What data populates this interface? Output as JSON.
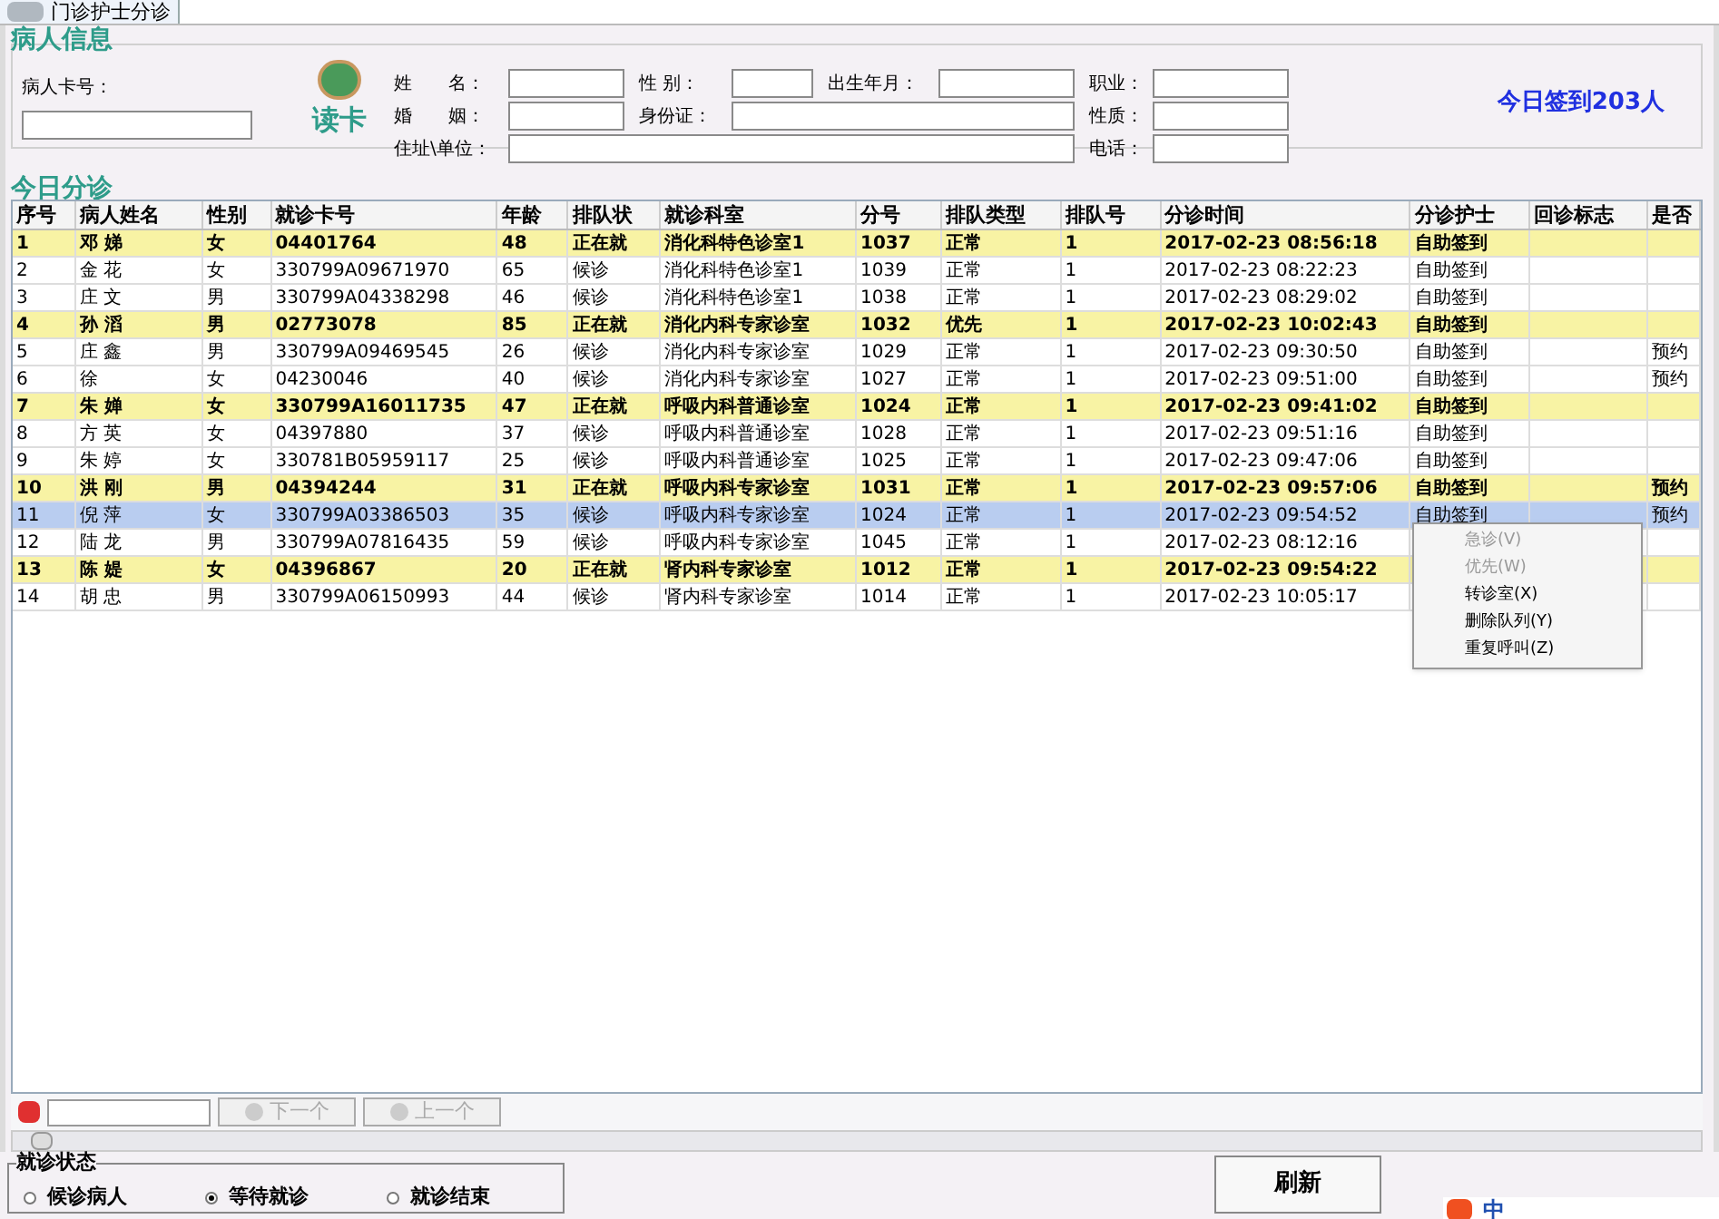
{
  "tab": {
    "label": "门诊护士分诊",
    "selected": true
  },
  "patient_info": {
    "title": "病人信息",
    "card_label": "病人卡号：",
    "read_card": "读卡",
    "signed_in": "今日签到203人",
    "field_rows": [
      [
        "姓　　名：",
        "性 别：",
        "出生年月：",
        "职业："
      ],
      [
        "婚　　姻：",
        "身份证：",
        "性质："
      ],
      [
        "住址\\单位：",
        "电话："
      ]
    ]
  },
  "triage": {
    "title": "今日分诊",
    "columns": [
      "序号",
      "病人姓名",
      "性别",
      "就诊卡号",
      "年龄",
      "排队状",
      "就诊科室",
      "分号",
      "排队类型",
      "排队号",
      "分诊时间",
      "分诊护士",
      "回诊标志",
      "是否"
    ],
    "rows": [
      {
        "cells": [
          "1",
          "邓 娣",
          "女",
          "04401764",
          "48",
          "正在就",
          "消化科特色诊室1",
          "1037",
          "正常",
          "1",
          "2017-02-23 08:56:18",
          "自助签到",
          "",
          ""
        ],
        "highlighted": true,
        "selected": false
      },
      {
        "cells": [
          "2",
          "金 花",
          "女",
          "330799A09671970",
          "65",
          "候诊",
          "消化科特色诊室1",
          "1039",
          "正常",
          "1",
          "2017-02-23 08:22:23",
          "自助签到",
          "",
          ""
        ],
        "highlighted": false,
        "selected": false
      },
      {
        "cells": [
          "3",
          "庄 文",
          "男",
          "330799A04338298",
          "46",
          "候诊",
          "消化科特色诊室1",
          "1038",
          "正常",
          "1",
          "2017-02-23 08:29:02",
          "自助签到",
          "",
          ""
        ],
        "highlighted": false,
        "selected": false
      },
      {
        "cells": [
          "4",
          "孙 滔",
          "男",
          "02773078",
          "85",
          "正在就",
          "消化内科专家诊室",
          "1032",
          "优先",
          "1",
          "2017-02-23 10:02:43",
          "自助签到",
          "",
          ""
        ],
        "highlighted": true,
        "selected": false
      },
      {
        "cells": [
          "5",
          "庄 鑫",
          "男",
          "330799A09469545",
          "26",
          "候诊",
          "消化内科专家诊室",
          "1029",
          "正常",
          "1",
          "2017-02-23 09:30:50",
          "自助签到",
          "",
          "预约"
        ],
        "highlighted": false,
        "selected": false
      },
      {
        "cells": [
          "6",
          "徐",
          "女",
          "04230046",
          "40",
          "候诊",
          "消化内科专家诊室",
          "1027",
          "正常",
          "1",
          "2017-02-23 09:51:00",
          "自助签到",
          "",
          "预约"
        ],
        "highlighted": false,
        "selected": false
      },
      {
        "cells": [
          "7",
          "朱 婵",
          "女",
          "330799A16011735",
          "47",
          "正在就",
          "呼吸内科普通诊室",
          "1024",
          "正常",
          "1",
          "2017-02-23 09:41:02",
          "自助签到",
          "",
          ""
        ],
        "highlighted": true,
        "selected": false
      },
      {
        "cells": [
          "8",
          "方 英",
          "女",
          "04397880",
          "37",
          "候诊",
          "呼吸内科普通诊室",
          "1028",
          "正常",
          "1",
          "2017-02-23 09:51:16",
          "自助签到",
          "",
          ""
        ],
        "highlighted": false,
        "selected": false
      },
      {
        "cells": [
          "9",
          "朱 婷",
          "女",
          "330781B05959117",
          "25",
          "候诊",
          "呼吸内科普通诊室",
          "1025",
          "正常",
          "1",
          "2017-02-23 09:47:06",
          "自助签到",
          "",
          ""
        ],
        "highlighted": false,
        "selected": false
      },
      {
        "cells": [
          "10",
          "洪 刚",
          "男",
          "04394244",
          "31",
          "正在就",
          "呼吸内科专家诊室",
          "1031",
          "正常",
          "1",
          "2017-02-23 09:57:06",
          "自助签到",
          "",
          "预约"
        ],
        "highlighted": true,
        "selected": false
      },
      {
        "cells": [
          "11",
          "倪 萍",
          "女",
          "330799A03386503",
          "35",
          "候诊",
          "呼吸内科专家诊室",
          "1024",
          "正常",
          "1",
          "2017-02-23 09:54:52",
          "自助签到",
          "",
          "预约"
        ],
        "highlighted": false,
        "selected": true
      },
      {
        "cells": [
          "12",
          "陆 龙",
          "男",
          "330799A07816435",
          "59",
          "候诊",
          "呼吸内科专家诊室",
          "1045",
          "正常",
          "1",
          "2017-02-23 08:12:16",
          "",
          "",
          ""
        ],
        "highlighted": false,
        "selected": false
      },
      {
        "cells": [
          "13",
          "陈 媞",
          "女",
          "04396867",
          "20",
          "正在就",
          "肾内科专家诊室",
          "1012",
          "正常",
          "1",
          "2017-02-23 09:54:22",
          "",
          "",
          ""
        ],
        "highlighted": true,
        "selected": false
      },
      {
        "cells": [
          "14",
          "胡 忠",
          "男",
          "330799A06150993",
          "44",
          "候诊",
          "肾内科专家诊室",
          "1014",
          "正常",
          "1",
          "2017-02-23 10:05:17",
          "",
          "",
          ""
        ],
        "highlighted": false,
        "selected": false
      }
    ]
  },
  "context_menu": [
    {
      "label": "急诊(V)",
      "disabled": true
    },
    {
      "label": "优先(W)",
      "disabled": true
    },
    {
      "label": "转诊室(X)",
      "disabled": false
    },
    {
      "label": "删除队列(Y)",
      "disabled": false
    },
    {
      "label": "重复呼叫(Z)",
      "disabled": false
    }
  ],
  "search_bar": {
    "next": "下一个",
    "prev": "上一个"
  },
  "visit_status": {
    "title": "就诊状态",
    "options": [
      {
        "label": "候诊病人",
        "selected": false
      },
      {
        "label": "等待就诊",
        "selected": true
      },
      {
        "label": "就诊结束",
        "selected": false
      }
    ]
  },
  "refresh_button": "刷新",
  "ime_bar": {
    "label": "中"
  }
}
